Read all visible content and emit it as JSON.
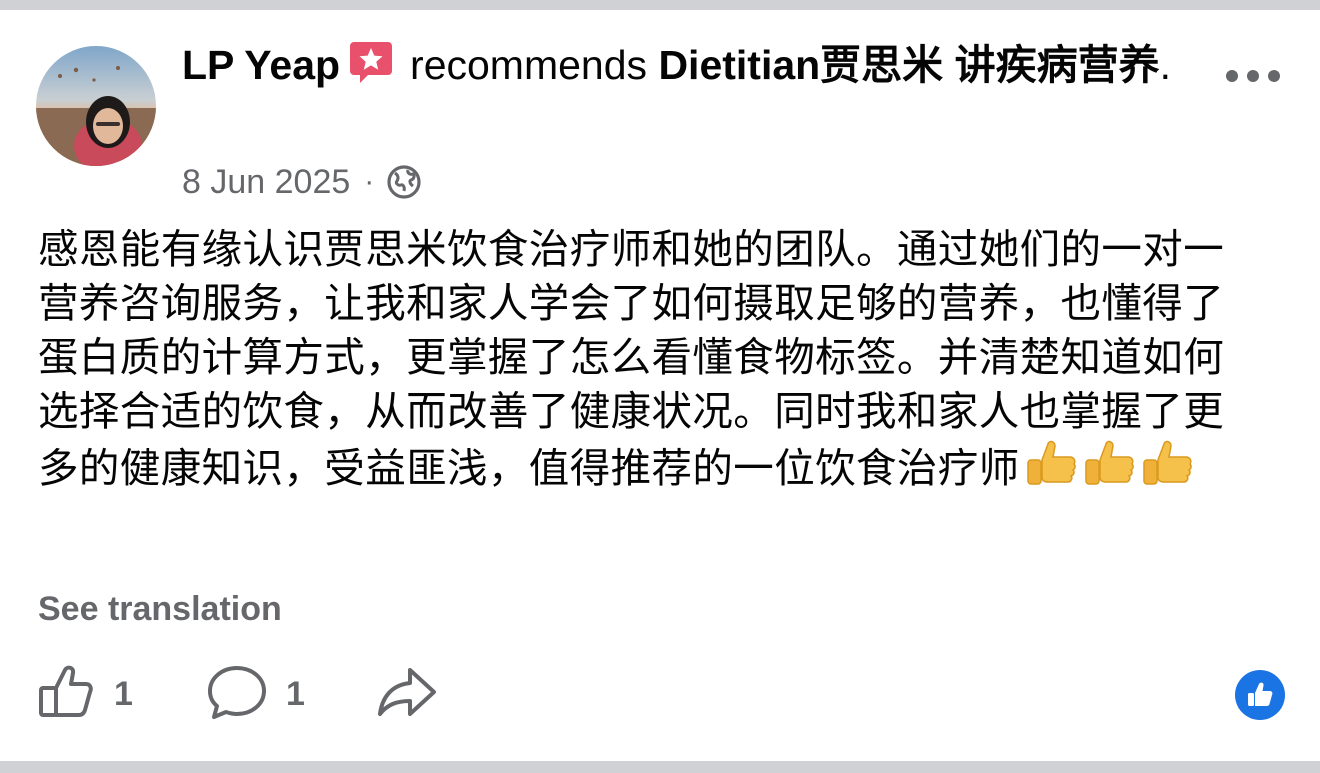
{
  "post": {
    "author": "LP Yeap",
    "action_text": "recommends",
    "page_name": "Dietitian贾思米 讲疾病营养",
    "trailing_punct": ".",
    "date": "8 Jun 2025",
    "separator": "·",
    "privacy_icon": "globe-icon",
    "badge_icon": "recommendation-star-icon",
    "body_text": "感恩能有缘认识贾思米饮食治疗师和她的团队。通过她们的一对一营养咨询服务，让我和家人学会了如何摄取足够的营养，也懂得了蛋白质的计算方式，更掌握了怎么看懂食物标签。并清楚知道如何选择合适的饮食，从而改善了健康状况。同时我和家人也掌握了更多的健康知识，受益匪浅，值得推荐的一位饮食治疗师",
    "emoji": [
      "thumbs-up",
      "thumbs-up",
      "thumbs-up"
    ],
    "see_translation": "See translation"
  },
  "actions": {
    "like_count": "1",
    "comment_count": "1",
    "like_icon": "thumbs-up-outline-icon",
    "comment_icon": "comment-bubble-icon",
    "share_icon": "share-arrow-icon",
    "reaction_icon": "like-reaction-icon"
  },
  "colors": {
    "secondary_text": "#65676b",
    "badge_red": "#e8506b",
    "reaction_blue": "#1b74e4",
    "separator_band": "#cfd1d5"
  }
}
